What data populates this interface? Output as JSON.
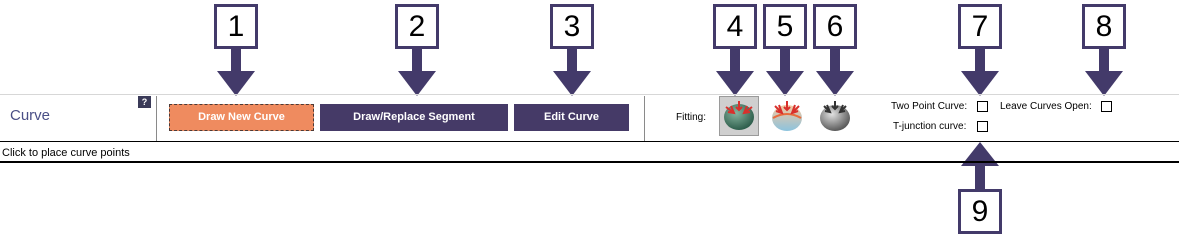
{
  "panel": {
    "title": "Curve",
    "help_badge": "?",
    "status_message": "Click to place curve points"
  },
  "toolbar": {
    "buttons": [
      {
        "label": "Draw New Curve",
        "active": true
      },
      {
        "label": "Draw/Replace Segment",
        "active": false
      },
      {
        "label": "Edit Curve",
        "active": false
      }
    ]
  },
  "fitting": {
    "label": "Fitting:",
    "icons": [
      {
        "name": "fit-option-1-icon",
        "selected": true
      },
      {
        "name": "fit-option-2-icon",
        "selected": false
      },
      {
        "name": "fit-option-3-icon",
        "selected": false
      }
    ]
  },
  "options": {
    "two_point_curve": {
      "label": "Two Point Curve:",
      "checked": false
    },
    "leave_curves_open": {
      "label": "Leave Curves Open:",
      "checked": false
    },
    "t_junction_curve": {
      "label": "T-junction curve:",
      "checked": false
    }
  },
  "callouts": [
    "1",
    "2",
    "3",
    "4",
    "5",
    "6",
    "7",
    "8",
    "9"
  ],
  "colors": {
    "primary_button": "#453a67",
    "active_button": "#ef8b5f",
    "callout": "#433a6a",
    "panel_title": "#4a4f86"
  }
}
